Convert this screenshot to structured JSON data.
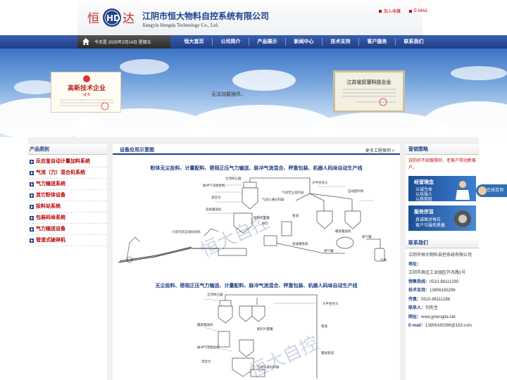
{
  "header": {
    "company_cn": "江阴市恒大物料自控系统有限公司",
    "company_en": "Jiangyin Hengda Technology Co., Ltd.",
    "logo_text_left": "恒",
    "logo_text_right": "达",
    "logo_mark": "HD",
    "toplinks": [
      "加入收藏",
      "E-MAIL"
    ],
    "accent": "#1f3f86"
  },
  "nav": {
    "date": "今天是 2025年2月14日 星期五",
    "items": [
      "恒大首页",
      "公司简介",
      "产品展示",
      "新闻中心",
      "技术支持",
      "客户服务",
      "联系我们"
    ]
  },
  "banner": {
    "message": "无法加载插件。",
    "cert_left_title": "高新技术企业",
    "cert_left_sub": "证书",
    "cert_right_title": "江苏省民营科技企业"
  },
  "left_sidebar": {
    "title": "产品类别",
    "categories": [
      "反应釜自动计量加料系统",
      "气流（力）混合机系统",
      "气力输送系统",
      "其它粉体设备",
      "投料站系统",
      "包装码垛系统",
      "气力输送设备",
      "管道式破碎机"
    ]
  },
  "main": {
    "title": "设备应用示意图",
    "more": "更多工程案例 >",
    "diagram1_title": "粉体无尘投料、计量配料、密相正压气力输送、脉冲气流混合、秤重包装、机器人码垛自动生产线",
    "diagram2_title": "无尘投料、密相正压气力输送、计量配料、脉冲气流混合、秤重包装、机器人码垛自动生产线",
    "d1_labels": [
      "大半径弯头",
      "仓顶除尘器",
      "脉冲气流混合机",
      "混合仓",
      "管道",
      "连续输送机",
      "螺旋输送机",
      "吸气罐",
      "小袋包装自动码垛机",
      "发送罐系统",
      "储气罐",
      "料仓",
      "气源",
      "气动三通分料器",
      "气动无尘投料站",
      "自动配料机",
      "配料计量罐"
    ],
    "d2_labels": [
      "仓顶除尘器",
      "大半径弯头",
      "螺旋输送机",
      "配料计量罐",
      "脉冲气流混合机",
      "混合仓",
      "管道",
      "气动三通分料器",
      "料仓",
      "输送管道"
    ],
    "watermark": "恒大自控"
  },
  "right_sidebar": {
    "strategy_title": "营销策略",
    "strategy_text": "说的好不如做得好，老客户带动新客户。",
    "promo1": {
      "head": "经营理念",
      "lines": [
        "以诚为本",
        "以技服人",
        "以质取胜"
      ]
    },
    "promo2": {
      "head": "服务宗旨",
      "lines": [
        "真诚面对每位",
        "客户与服务质量"
      ]
    },
    "contact_title": "联系我们",
    "company": "江阴市恒大物料自控系统有限公司",
    "address_label": "地址：",
    "address": "江阴市周庄工业园区开兆路1号",
    "sales_label": "销售热线：",
    "sales": "0510-86111280",
    "tech_label": "技术支持：",
    "tech": "13806165296",
    "fax_label": "传真：",
    "fax": "0510-86111286",
    "person_label": "联系人：",
    "person": "刘先生",
    "web_label": "网址：",
    "web": "www.jyhengda.net",
    "email_label": "E-mail：",
    "email": "13806165296@163.com"
  },
  "chat": {
    "label": "在线咨询"
  }
}
